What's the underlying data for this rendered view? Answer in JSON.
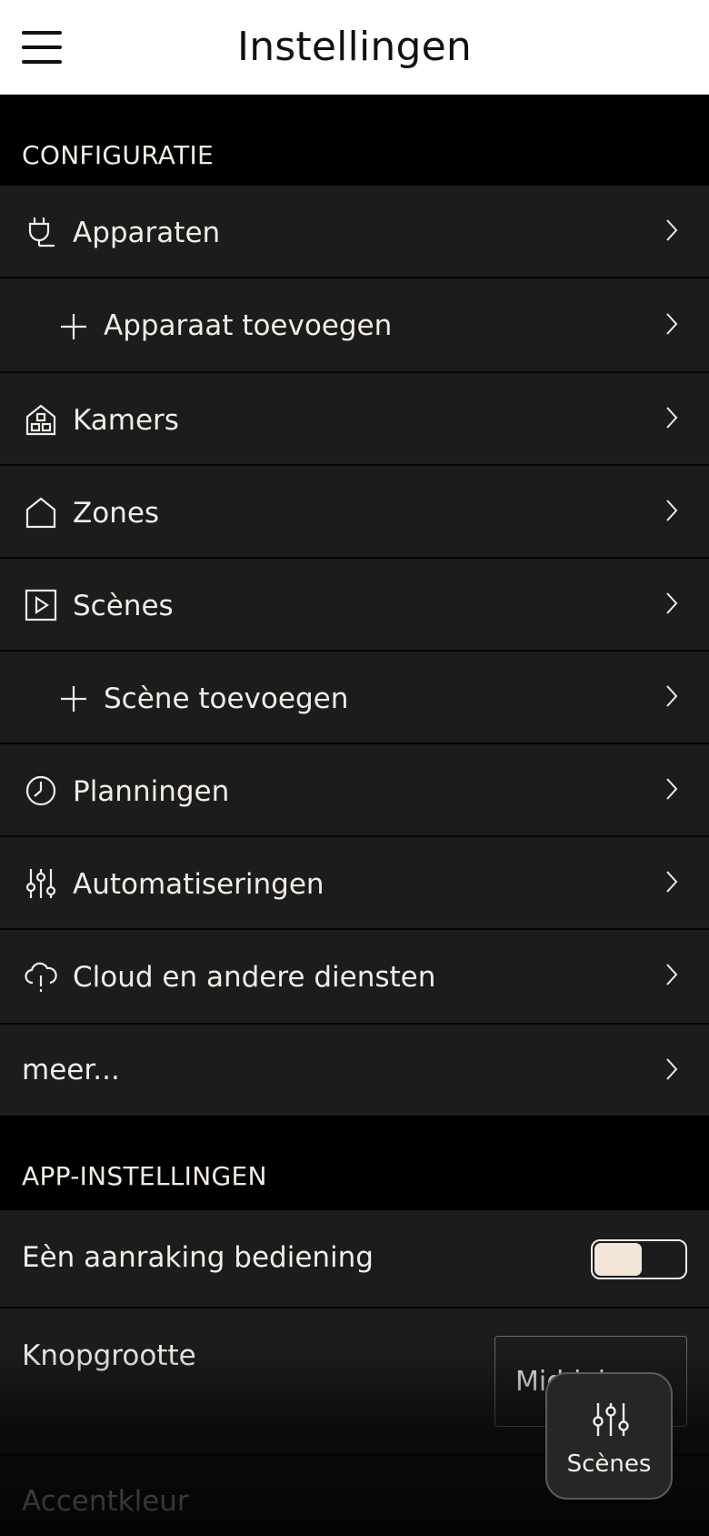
{
  "header": {
    "title": "Instellingen"
  },
  "sections": {
    "configuratie": "CONFIGURATIE",
    "app_instellingen": "APP-INSTELLINGEN"
  },
  "rows": {
    "apparaten": {
      "label": "Apparaten",
      "icon": "plug-icon"
    },
    "apparaat_toevoegen": {
      "label": "Apparaat toevoegen",
      "icon": "plus-icon"
    },
    "kamers": {
      "label": "Kamers",
      "icon": "rooms-house-icon"
    },
    "zones": {
      "label": "Zones",
      "icon": "home-outline-icon"
    },
    "scenes": {
      "label": "Scènes",
      "icon": "play-square-icon"
    },
    "scene_toevoegen": {
      "label": "Scène toevoegen",
      "icon": "plus-icon"
    },
    "planningen": {
      "label": "Planningen",
      "icon": "clock-icon"
    },
    "automatiseringen": {
      "label": "Automatiseringen",
      "icon": "sliders-icon"
    },
    "cloud": {
      "label": "Cloud en andere diensten",
      "icon": "cloud-icon"
    },
    "meer": {
      "label": "meer..."
    }
  },
  "app_settings": {
    "one_touch": {
      "label": "Eèn aanraking bediening",
      "enabled": false
    },
    "button_size": {
      "label": "Knopgrootte",
      "value": "Middel"
    },
    "accent_color": {
      "label": "Accentkleur"
    }
  },
  "fab": {
    "label": "Scènes",
    "icon": "sliders-icon"
  },
  "colors": {
    "background": "#000000",
    "row": "#1c1c1c",
    "text": "#f1ece6",
    "header": "#ffffff"
  }
}
